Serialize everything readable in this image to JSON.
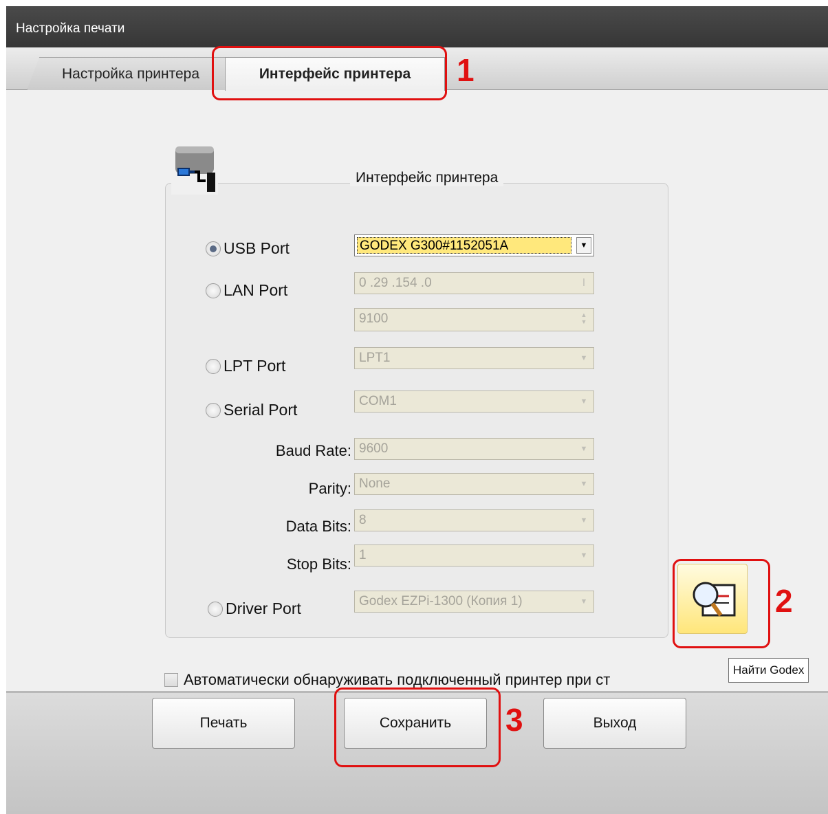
{
  "window": {
    "title": "Настройка печати"
  },
  "tabs": [
    {
      "label": "Настройка принтера"
    },
    {
      "label": "Интерфейс принтера"
    }
  ],
  "group": {
    "title": "Интерфейс принтера"
  },
  "ports": {
    "usb": {
      "label": "USB Port",
      "value": "GODEX G300#1152051A",
      "selected": true
    },
    "lan": {
      "label": "LAN Port",
      "ip": "0 .29 .154 .0",
      "port": "9100"
    },
    "lpt": {
      "label": "LPT Port",
      "value": "LPT1"
    },
    "serial": {
      "label": "Serial Port",
      "value": "COM1"
    },
    "driver": {
      "label": "Driver Port",
      "value": "Godex EZPi-1300 (Копия 1)"
    }
  },
  "serial_settings": {
    "baud": {
      "label": "Baud Rate:",
      "value": "9600"
    },
    "parity": {
      "label": "Parity:",
      "value": "None"
    },
    "data_bits": {
      "label": "Data Bits:",
      "value": "8"
    },
    "stop_bits": {
      "label": "Stop Bits:",
      "value": "1"
    }
  },
  "tooltip": "Найти Godex",
  "auto_detect": {
    "label": "Автоматически обнаруживать подключенный принтер при ст",
    "checked": false
  },
  "buttons": {
    "print": "Печать",
    "save": "Сохранить",
    "exit": "Выход"
  },
  "annotations": {
    "one": "1",
    "two": "2",
    "three": "3"
  },
  "colors": {
    "highlight": "#e01010",
    "selection": "#ffe87c"
  },
  "icons": {
    "group": "printer-port-icon",
    "find": "find-printer-icon"
  }
}
